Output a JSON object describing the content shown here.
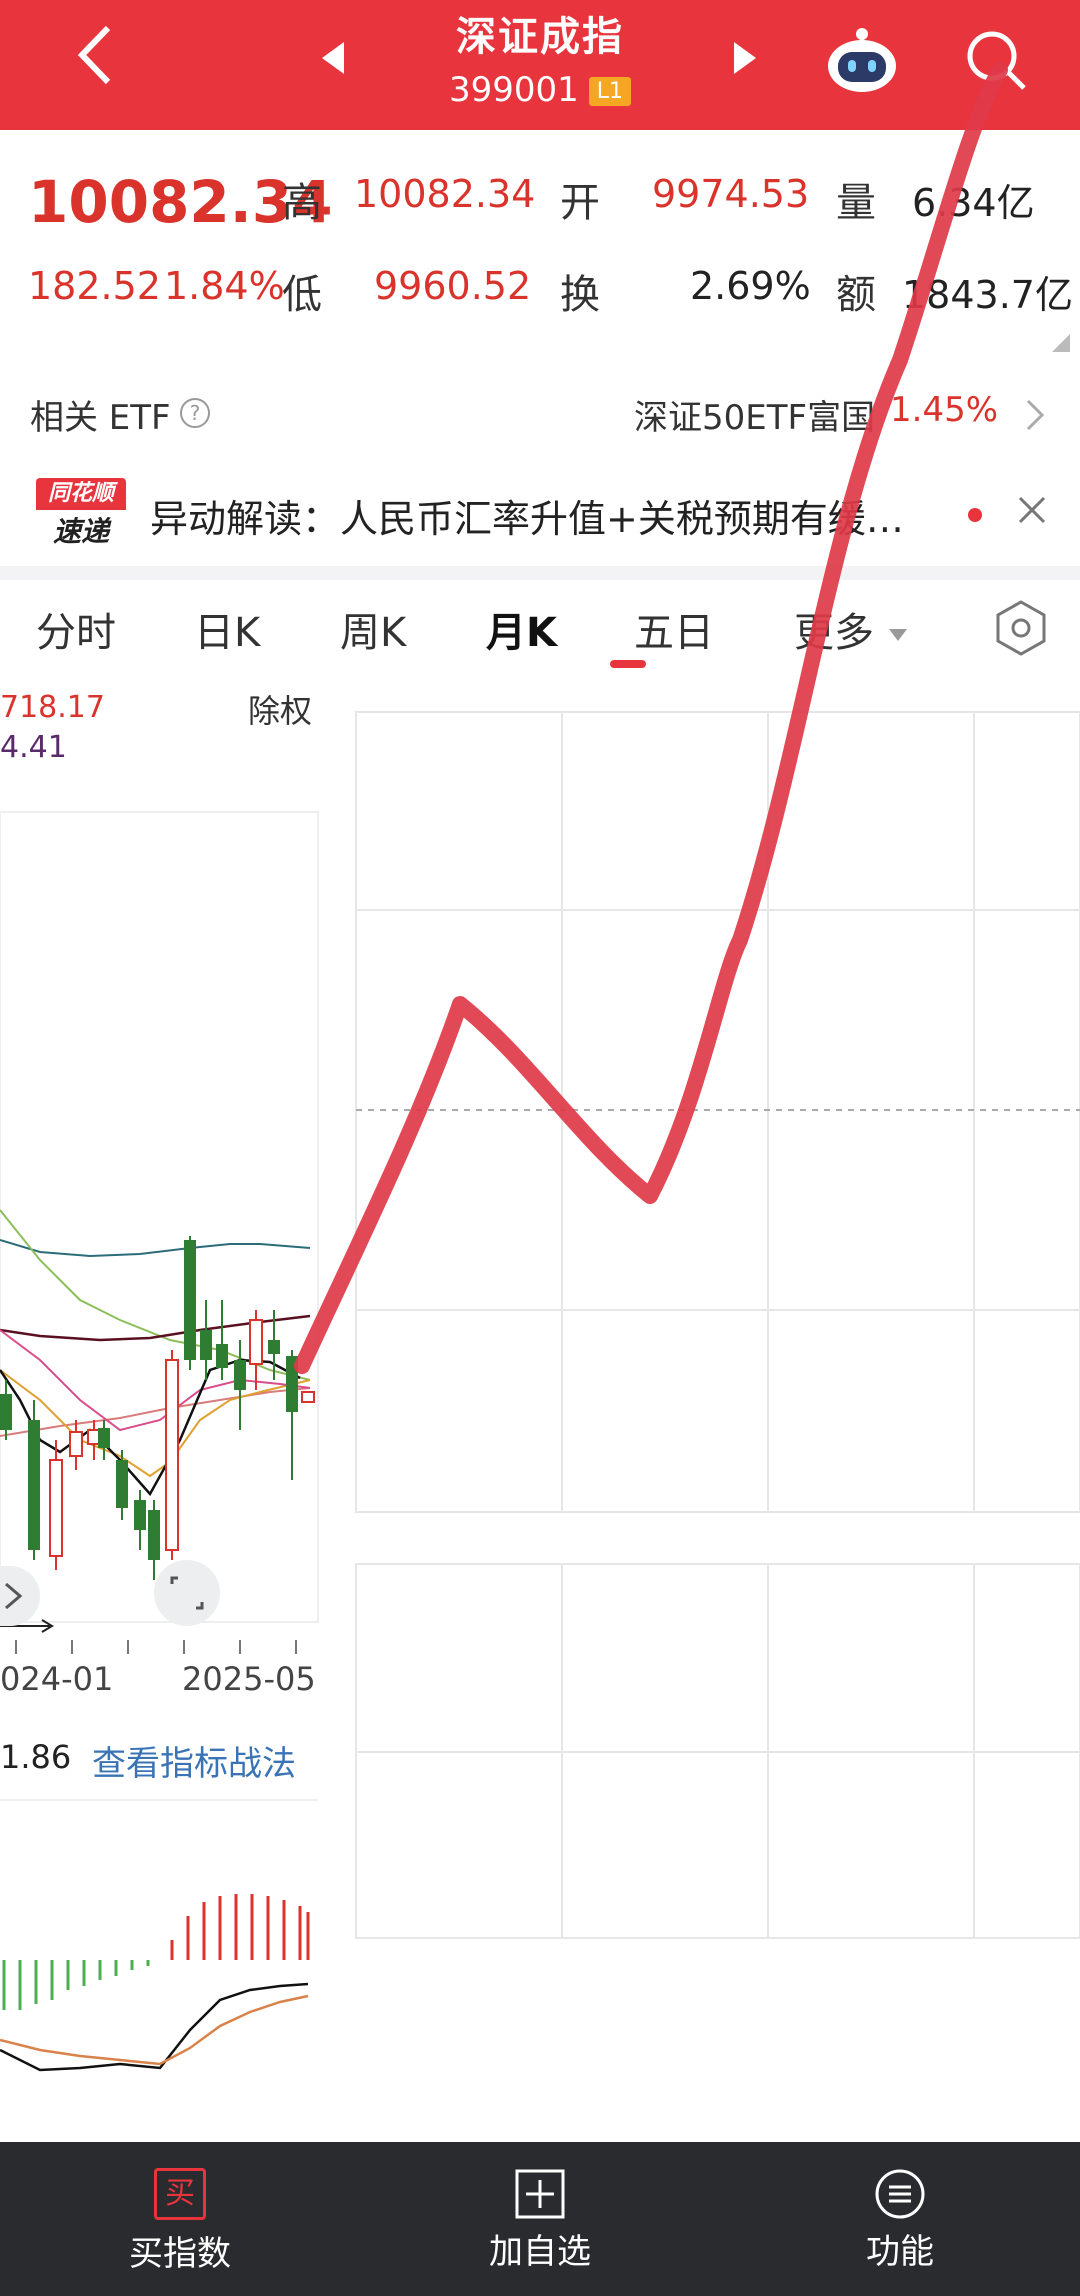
{
  "header": {
    "title": "深证成指",
    "code": "399001",
    "level": "L1"
  },
  "quote": {
    "price": "10082.34",
    "change": "182.52",
    "change_pct": "1.84%",
    "high_label": "高",
    "high": "10082.34",
    "open_label": "开",
    "open": "9974.53",
    "volume_label": "量",
    "volume": "6.34亿",
    "low_label": "低",
    "low": "9960.52",
    "turnover_label": "换",
    "turnover": "2.69%",
    "amount_label": "额",
    "amount": "1843.7亿"
  },
  "etf": {
    "label": "相关 ETF",
    "name": "深证50ETF富国",
    "change": "1.45%"
  },
  "news": {
    "badge_top": "同花顺",
    "badge_bottom": "速递",
    "text": "异动解读：人民币汇率升值+关税预期有缓…"
  },
  "tabs": [
    {
      "label": "分时"
    },
    {
      "label": "日K"
    },
    {
      "label": "周K"
    },
    {
      "label": "月K"
    },
    {
      "label": "五日"
    },
    {
      "label": "更多"
    }
  ],
  "chart": {
    "ma_value_1": "718.17",
    "ma_value_2": "4.41",
    "adjust_label": "除权",
    "date_left": "024-01",
    "date_right": "2025-05",
    "indicator_value": "1.86",
    "indicator_link": "查看指标战法"
  },
  "bottom": {
    "buy_icon_char": "买",
    "buy_label": "买指数",
    "add_label": "加自选",
    "func_label": "功能"
  },
  "colors": {
    "header_red": "#e8343d",
    "up_red": "#d9332b",
    "down_green": "#2e7d32",
    "annotation_red": "#e03a48"
  }
}
